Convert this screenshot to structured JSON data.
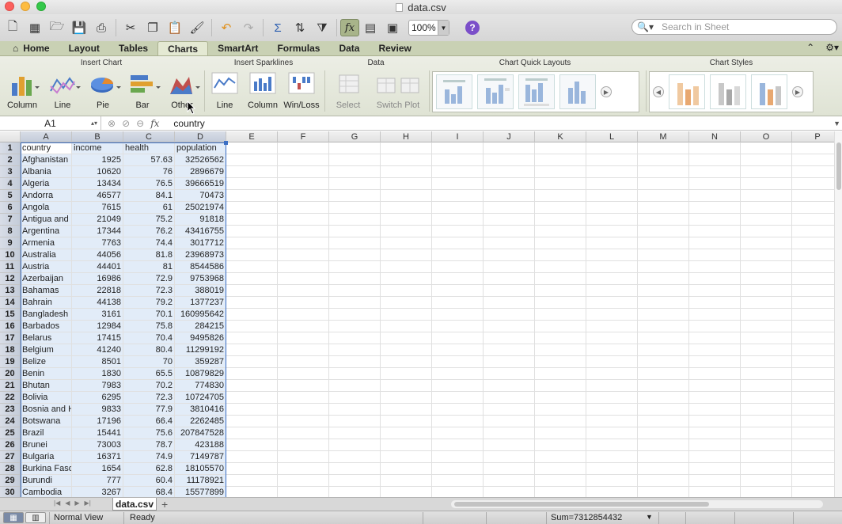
{
  "window": {
    "title": "data.csv"
  },
  "toolbar": {
    "zoom": "100%",
    "search_placeholder": "Search in Sheet"
  },
  "tabs": [
    "Home",
    "Layout",
    "Tables",
    "Charts",
    "SmartArt",
    "Formulas",
    "Data",
    "Review"
  ],
  "active_tab": "Charts",
  "ribbon": {
    "insert_chart": {
      "title": "Insert Chart",
      "buttons": [
        "Column",
        "Line",
        "Pie",
        "Bar",
        "Other"
      ]
    },
    "insert_sparklines": {
      "title": "Insert Sparklines",
      "buttons": [
        "Line",
        "Column",
        "Win/Loss"
      ]
    },
    "data": {
      "title": "Data",
      "buttons": [
        "Select",
        "Switch Plot"
      ]
    },
    "quick_layouts": {
      "title": "Chart Quick Layouts"
    },
    "chart_styles": {
      "title": "Chart Styles"
    }
  },
  "formula_bar": {
    "name_box": "A1",
    "fx": "fx",
    "content": "country"
  },
  "columns": [
    "A",
    "B",
    "C",
    "D",
    "E",
    "F",
    "G",
    "H",
    "I",
    "J",
    "K",
    "L",
    "M",
    "N",
    "O",
    "P"
  ],
  "rows": [
    [
      "country",
      "income",
      "health",
      "population"
    ],
    [
      "Afghanistan",
      "1925",
      "57.63",
      "32526562"
    ],
    [
      "Albania",
      "10620",
      "76",
      "2896679"
    ],
    [
      "Algeria",
      "13434",
      "76.5",
      "39666519"
    ],
    [
      "Andorra",
      "46577",
      "84.1",
      "70473"
    ],
    [
      "Angola",
      "7615",
      "61",
      "25021974"
    ],
    [
      "Antigua and",
      "21049",
      "75.2",
      "91818"
    ],
    [
      "Argentina",
      "17344",
      "76.2",
      "43416755"
    ],
    [
      "Armenia",
      "7763",
      "74.4",
      "3017712"
    ],
    [
      "Australia",
      "44056",
      "81.8",
      "23968973"
    ],
    [
      "Austria",
      "44401",
      "81",
      "8544586"
    ],
    [
      "Azerbaijan",
      "16986",
      "72.9",
      "9753968"
    ],
    [
      "Bahamas",
      "22818",
      "72.3",
      "388019"
    ],
    [
      "Bahrain",
      "44138",
      "79.2",
      "1377237"
    ],
    [
      "Bangladesh",
      "3161",
      "70.1",
      "160995642"
    ],
    [
      "Barbados",
      "12984",
      "75.8",
      "284215"
    ],
    [
      "Belarus",
      "17415",
      "70.4",
      "9495826"
    ],
    [
      "Belgium",
      "41240",
      "80.4",
      "11299192"
    ],
    [
      "Belize",
      "8501",
      "70",
      "359287"
    ],
    [
      "Benin",
      "1830",
      "65.5",
      "10879829"
    ],
    [
      "Bhutan",
      "7983",
      "70.2",
      "774830"
    ],
    [
      "Bolivia",
      "6295",
      "72.3",
      "10724705"
    ],
    [
      "Bosnia and H",
      "9833",
      "77.9",
      "3810416"
    ],
    [
      "Botswana",
      "17196",
      "66.4",
      "2262485"
    ],
    [
      "Brazil",
      "15441",
      "75.6",
      "207847528"
    ],
    [
      "Brunei",
      "73003",
      "78.7",
      "423188"
    ],
    [
      "Bulgaria",
      "16371",
      "74.9",
      "7149787"
    ],
    [
      "Burkina Faso",
      "1654",
      "62.8",
      "18105570"
    ],
    [
      "Burundi",
      "777",
      "60.4",
      "11178921"
    ],
    [
      "Cambodia",
      "3267",
      "68.4",
      "15577899"
    ]
  ],
  "sheet_tab": "data.csv",
  "status": {
    "view": "Normal View",
    "state": "Ready",
    "sum": "Sum=7312854432"
  }
}
